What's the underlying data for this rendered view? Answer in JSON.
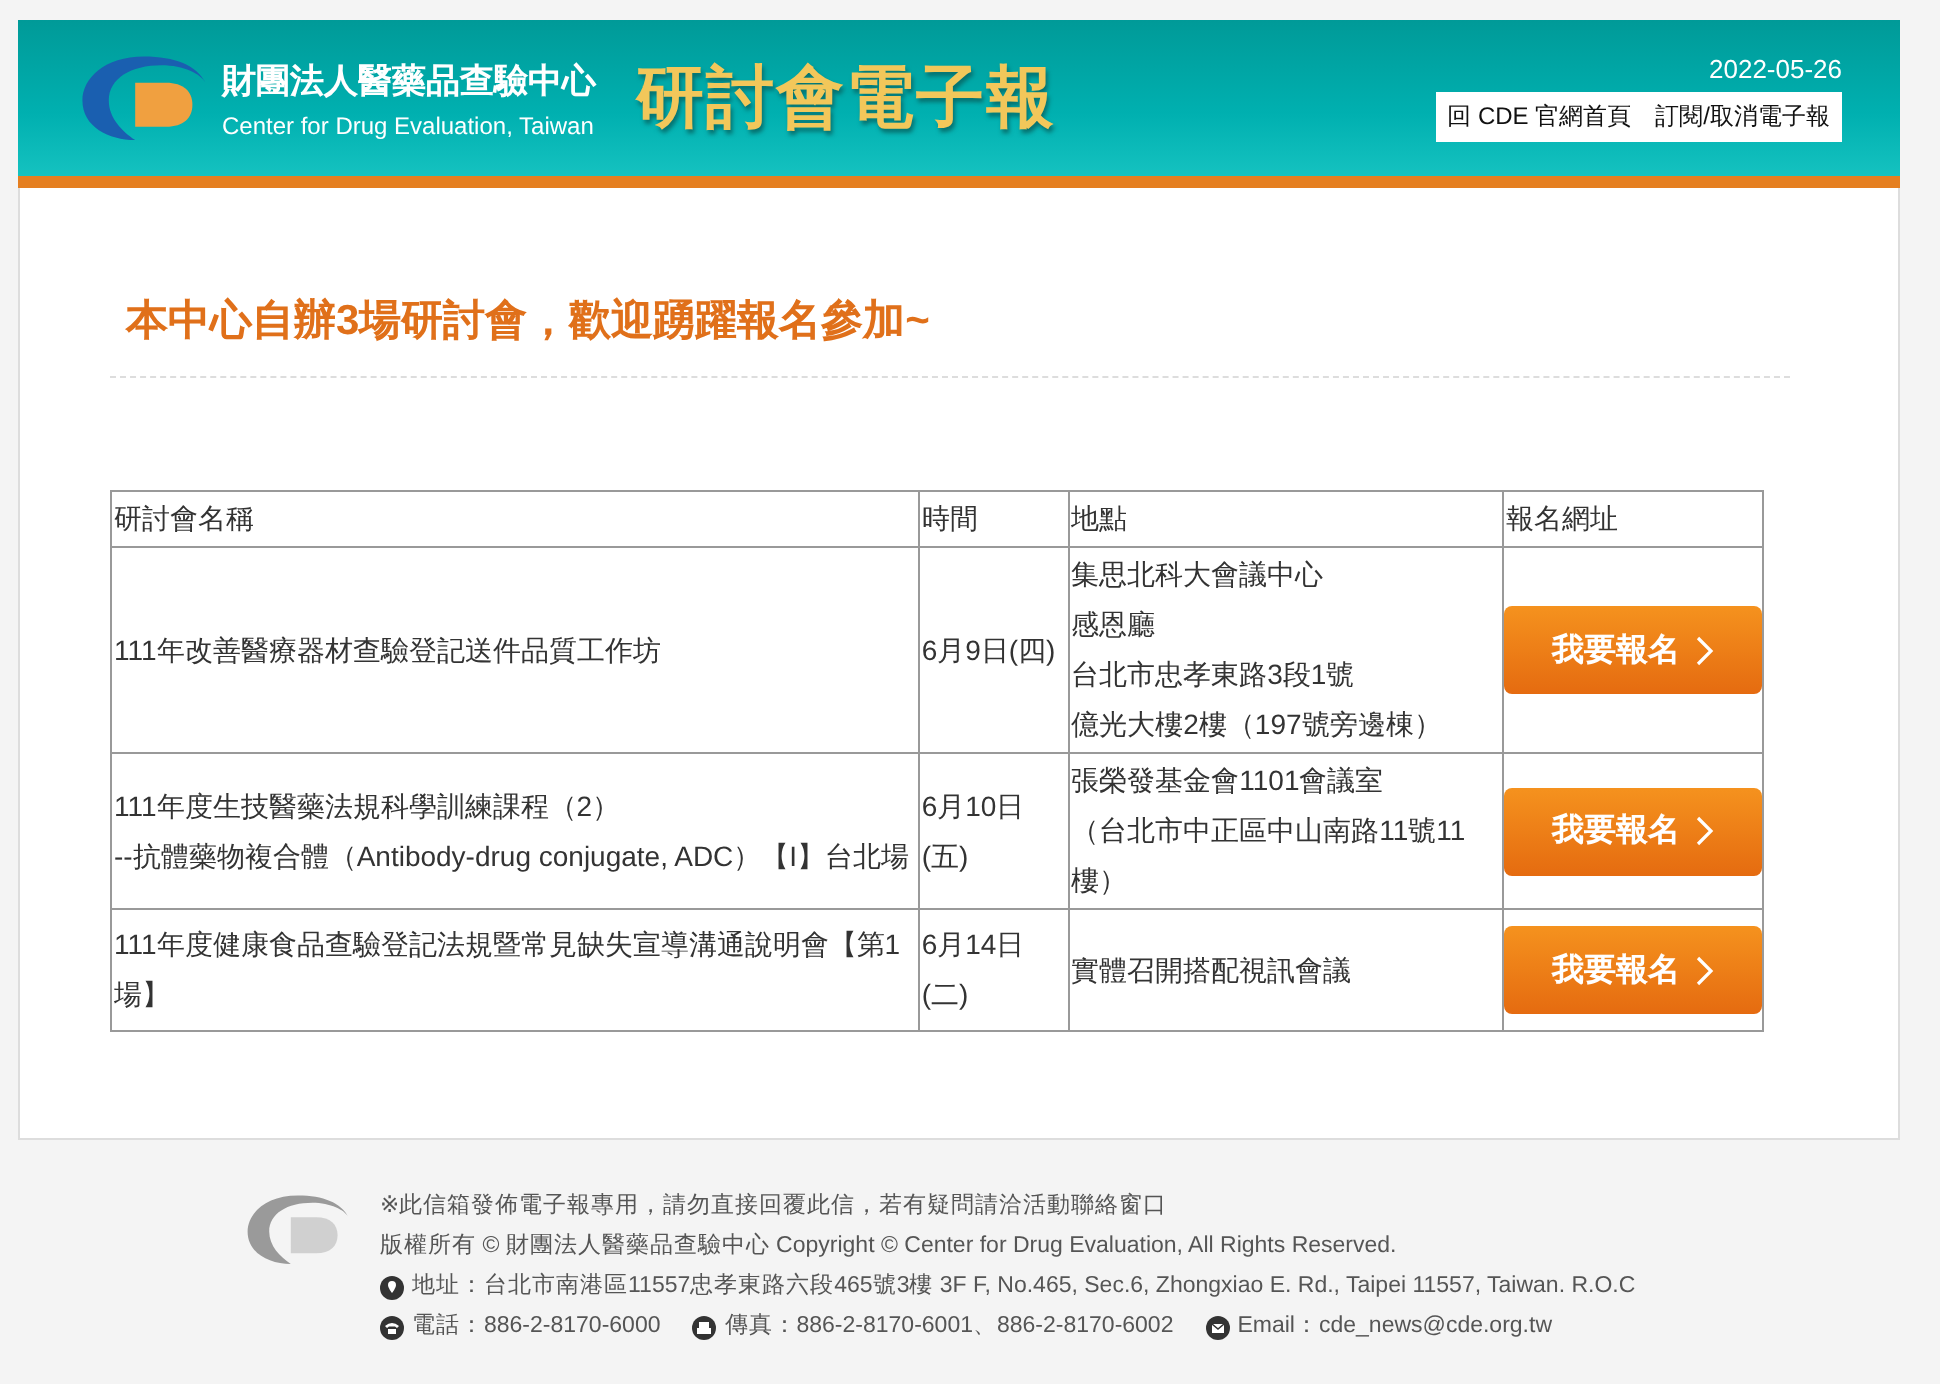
{
  "header": {
    "org_name": "財團法人醫藥品查驗中心",
    "org_name_en": "Center for Drug Evaluation, Taiwan",
    "title": "研討會電子報",
    "date": "2022-05-26",
    "links": [
      "回 CDE 官網首頁",
      "訂閱/取消電子報"
    ]
  },
  "heading": "本中心自辦3場研討會，歡迎踴躍報名參加~",
  "table": {
    "columns": [
      "研討會名稱",
      "時間",
      "地點",
      "報名網址"
    ],
    "rows": [
      {
        "name": [
          "111年改善醫療器材查驗登記送件品質工作坊"
        ],
        "time": "6月9日(四)",
        "place": [
          "集思北科大會議中心",
          "感恩廳",
          "台北市忠孝東路3段1號",
          "億光大樓2樓（197號旁邊棟）"
        ],
        "button": "我要報名"
      },
      {
        "name": [
          "111年度生技醫藥法規科學訓練課程（2）",
          "--抗體藥物複合體（Antibody-drug conjugate, ADC）【I】台北場"
        ],
        "time": "6月10日(五)",
        "place": [
          "張榮發基金會1101會議室",
          "（台北市中正區中山南路11號11樓）"
        ],
        "button": "我要報名"
      },
      {
        "name": [
          "111年度健康食品查驗登記法規暨常見缺失宣導溝通說明會【第1場】"
        ],
        "time": "6月14日(二)",
        "place": [
          "實體召開搭配視訊會議"
        ],
        "button": "我要報名"
      }
    ]
  },
  "footer": {
    "notice": "※此信箱發佈電子報專用，請勿直接回覆此信，若有疑問請洽活動聯絡窗口",
    "copyright": "版權所有 © 財團法人醫藥品查驗中心 Copyright © Center for Drug Evaluation, All Rights Reserved.",
    "address": "地址：台北市南港區11557忠孝東路六段465號3樓 3F F, No.465, Sec.6, Zhongxiao E. Rd., Taipei 11557, Taiwan. R.O.C",
    "phone": "電話：886-2-8170-6000",
    "fax": "傳真：886-2-8170-6001、886-2-8170-6002",
    "email": "Email：cde_news@cde.org.tw"
  }
}
